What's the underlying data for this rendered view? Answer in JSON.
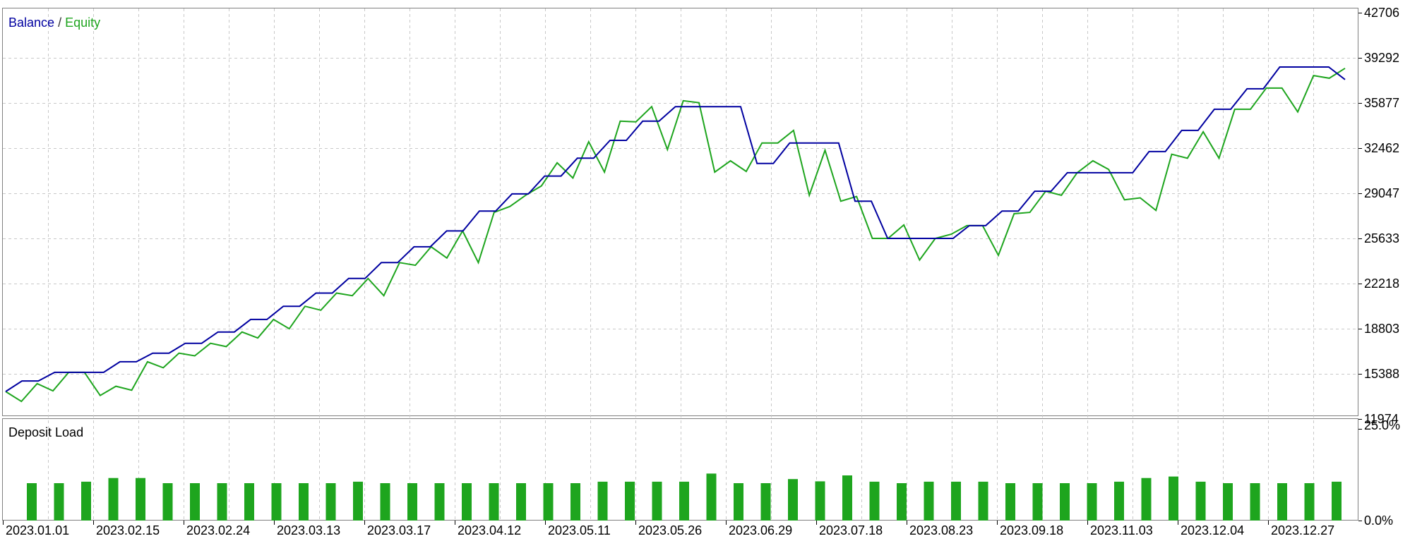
{
  "chart_data": [
    {
      "type": "line",
      "legend": {
        "balance_label": "Balance",
        "separator": " / ",
        "equity_label": "Equity",
        "placement": "top-left"
      },
      "colors": {
        "balance": "#0000a0",
        "equity": "#1ea51e",
        "grid": "#c8c8c8",
        "frame": "#808080"
      },
      "ylim": [
        11974,
        42706
      ],
      "y_ticks": [
        "42706",
        "39292",
        "35877",
        "32462",
        "29047",
        "25633",
        "22218",
        "18803",
        "15388",
        "11974"
      ],
      "x_ticks": [
        "2023.01.01",
        "2023.02.15",
        "2023.02.24",
        "2023.03.13",
        "2023.03.17",
        "2023.04.12",
        "2023.05.11",
        "2023.05.26",
        "2023.06.29",
        "2023.07.18",
        "2023.08.23",
        "2023.09.18",
        "2023.11.03",
        "2023.12.04",
        "2023.12.27"
      ],
      "grid": true,
      "series": [
        {
          "name": "Balance",
          "values": [
            14050,
            14850,
            14850,
            15500,
            15500,
            15500,
            15500,
            16300,
            16300,
            16950,
            16950,
            17700,
            17700,
            18550,
            18550,
            19500,
            19500,
            20500,
            20500,
            21500,
            21500,
            22600,
            22600,
            23800,
            23800,
            25000,
            25000,
            26200,
            26200,
            27700,
            27700,
            29000,
            29000,
            30350,
            30350,
            31700,
            31700,
            33050,
            33050,
            34500,
            34500,
            35600,
            35600,
            35600,
            35600,
            35600,
            31300,
            31300,
            32850,
            32850,
            32850,
            32850,
            28450,
            28450,
            25630,
            25630,
            25630,
            25630,
            25630,
            26600,
            26600,
            27700,
            27700,
            29200,
            29200,
            30600,
            30600,
            30600,
            30600,
            30600,
            32200,
            32200,
            33800,
            33800,
            35400,
            35400,
            36950,
            36950,
            38600,
            38600,
            38600,
            38600,
            37650
          ]
        },
        {
          "name": "Equity",
          "values": [
            14050,
            13300,
            14650,
            14100,
            15500,
            15500,
            13750,
            14450,
            14150,
            16300,
            15850,
            16950,
            16750,
            17700,
            17450,
            18550,
            18100,
            19500,
            18800,
            20500,
            20200,
            21500,
            21300,
            22600,
            21300,
            23800,
            23600,
            25000,
            24150,
            26200,
            23800,
            27600,
            28050,
            28900,
            29600,
            31350,
            30200,
            32950,
            30650,
            34500,
            34450,
            35600,
            32350,
            36050,
            35900,
            30650,
            31500,
            30700,
            32850,
            32850,
            33800,
            28900,
            32300,
            28450,
            28800,
            25630,
            25630,
            26650,
            24000,
            25630,
            25950,
            26600,
            26600,
            24350,
            27500,
            27600,
            29200,
            28900,
            30600,
            31500,
            30850,
            28550,
            28700,
            27750,
            32000,
            31700,
            33700,
            31700,
            35400,
            35400,
            37000,
            37000,
            35200,
            37950,
            37750,
            38500
          ]
        }
      ]
    },
    {
      "type": "bar",
      "title": "Deposit Load",
      "y_ticks": [
        "25.0%",
        "0.0%"
      ],
      "ylim": [
        0,
        25
      ],
      "color": "#1ea51e",
      "values": [
        10.2,
        10.2,
        10.6,
        11.6,
        11.6,
        10.2,
        10.2,
        10.2,
        10.2,
        10.2,
        10.2,
        10.2,
        10.6,
        10.2,
        10.2,
        10.2,
        10.2,
        10.2,
        10.2,
        10.2,
        10.2,
        10.6,
        10.6,
        10.6,
        10.6,
        12.8,
        10.2,
        10.2,
        11.3,
        10.7,
        12.3,
        10.6,
        10.2,
        10.6,
        10.6,
        10.6,
        10.2,
        10.2,
        10.2,
        10.2,
        10.6,
        11.6,
        12.0,
        10.6,
        10.2,
        10.2,
        10.2,
        10.2,
        10.6
      ]
    }
  ]
}
